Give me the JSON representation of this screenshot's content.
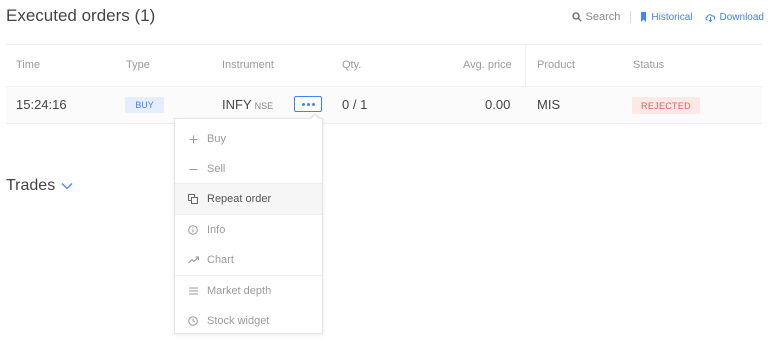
{
  "header": {
    "title": "Executed orders (1)",
    "search_label": "Search",
    "historical_label": "Historical",
    "download_label": "Download"
  },
  "table": {
    "columns": [
      "Time",
      "Type",
      "Instrument",
      "Qty.",
      "Avg. price",
      "Product",
      "Status"
    ],
    "rows": [
      {
        "time": "15:24:16",
        "type": "BUY",
        "instrument": "INFY",
        "exchange": "NSE",
        "qty": "0 / 1",
        "avg_price": "0.00",
        "product": "MIS",
        "status": "REJECTED"
      }
    ]
  },
  "context_menu": {
    "items": [
      {
        "label": "Buy",
        "icon": "plus-icon"
      },
      {
        "label": "Sell",
        "icon": "minus-icon"
      },
      {
        "label": "Repeat order",
        "icon": "copy-icon"
      },
      {
        "label": "Info",
        "icon": "info-icon"
      },
      {
        "label": "Chart",
        "icon": "trend-icon"
      },
      {
        "label": "Market depth",
        "icon": "list-icon"
      },
      {
        "label": "Stock widget",
        "icon": "widget-icon"
      }
    ]
  },
  "trades": {
    "title": "Trades"
  },
  "colors": {
    "accent": "#4184f3",
    "buy_bg": "#e5edff",
    "rejected_bg": "#fde8e8",
    "rejected_text": "#e25f5b",
    "text": "#444444",
    "muted": "#9b9b9b"
  }
}
